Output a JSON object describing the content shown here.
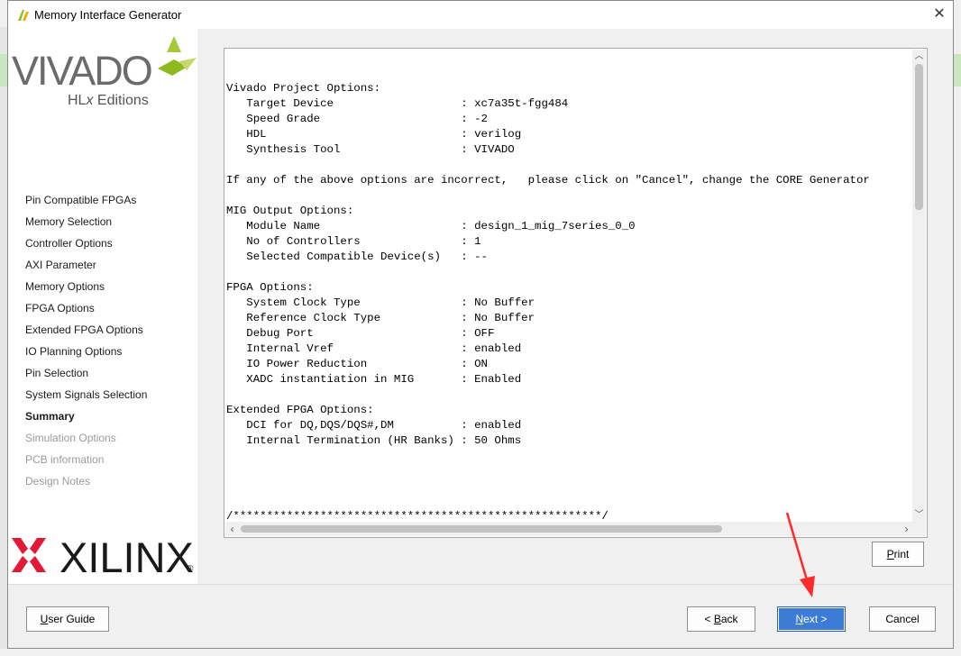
{
  "window": {
    "title": "Memory Interface Generator"
  },
  "brand": {
    "vivado_word": "VIVADO",
    "edition_pre": "HL",
    "edition_x": "x",
    "edition_post": " Editions",
    "xilinx_word": "XILINX",
    "registered": "®",
    "accent_color": "#8dba1f",
    "xilinx_red": "#e31837"
  },
  "sidebar": {
    "items": [
      {
        "label": "Pin Compatible FPGAs",
        "state": "normal"
      },
      {
        "label": "Memory Selection",
        "state": "normal"
      },
      {
        "label": "Controller Options",
        "state": "normal"
      },
      {
        "label": "AXI Parameter",
        "state": "normal"
      },
      {
        "label": "Memory Options",
        "state": "normal"
      },
      {
        "label": "FPGA Options",
        "state": "normal"
      },
      {
        "label": "Extended FPGA Options",
        "state": "normal"
      },
      {
        "label": "IO Planning Options",
        "state": "normal"
      },
      {
        "label": "Pin Selection",
        "state": "normal"
      },
      {
        "label": "System Signals Selection",
        "state": "normal"
      },
      {
        "label": "Summary",
        "state": "active"
      },
      {
        "label": "Simulation Options",
        "state": "disabled"
      },
      {
        "label": "PCB information",
        "state": "disabled"
      },
      {
        "label": "Design Notes",
        "state": "disabled"
      }
    ]
  },
  "summary": {
    "text": "Vivado Project Options:\n   Target Device                   : xc7a35t-fgg484\n   Speed Grade                     : -2\n   HDL                             : verilog\n   Synthesis Tool                  : VIVADO\n\nIf any of the above options are incorrect,   please click on \"Cancel\", change the CORE Generator\n\nMIG Output Options:\n   Module Name                     : design_1_mig_7series_0_0\n   No of Controllers               : 1\n   Selected Compatible Device(s)   : --\n\nFPGA Options:\n   System Clock Type               : No Buffer\n   Reference Clock Type            : No Buffer\n   Debug Port                      : OFF\n   Internal Vref                   : enabled\n   IO Power Reduction              : ON\n   XADC instantiation in MIG       : Enabled\n\nExtended FPGA Options:\n   DCI for DQ,DQS/DQS#,DM          : enabled\n   Internal Termination (HR Banks) : 50 Ohms",
    "separator": "/*******************************************************/"
  },
  "buttons": {
    "print": {
      "mnemonic": "P",
      "rest": "rint"
    },
    "user_guide": {
      "mnemonic": "U",
      "rest": "ser Guide"
    },
    "back": {
      "pre": "< ",
      "mnemonic": "B",
      "rest": "ack"
    },
    "next": {
      "mnemonic": "N",
      "rest": "ext >"
    },
    "cancel": {
      "label": "Cancel"
    }
  },
  "annotation": {
    "color": "#ff2a2a",
    "icon": "red-arrow-pointing-next"
  }
}
